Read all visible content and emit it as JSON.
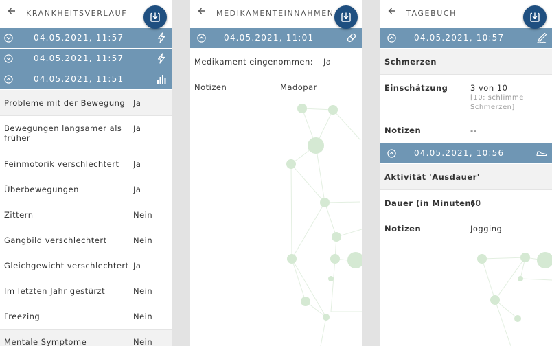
{
  "panel1": {
    "title": "KRANKHEITSVERLAUF",
    "entries": [
      {
        "datetime": "04.05.2021, 11:57",
        "icon": "lightning-icon"
      },
      {
        "datetime": "04.05.2021, 11:57",
        "icon": "lightning-icon"
      },
      {
        "datetime": "04.05.2021, 11:51",
        "icon": "bar-chart-icon"
      }
    ],
    "rows": [
      {
        "label": "Probleme mit der Bewegung",
        "value": "Ja"
      },
      {
        "label": "Bewegungen langsamer als früher",
        "value": "Ja"
      },
      {
        "label": "Feinmotorik verschlechtert",
        "value": "Ja"
      },
      {
        "label": "Überbewegungen",
        "value": "Ja"
      },
      {
        "label": "Zittern",
        "value": "Nein"
      },
      {
        "label": "Gangbild verschlechtert",
        "value": "Nein"
      },
      {
        "label": "Gleichgewicht verschlechtert",
        "value": "Ja"
      },
      {
        "label": "Im letzten Jahr gestürzt",
        "value": "Nein"
      },
      {
        "label": "Freezing",
        "value": "Nein"
      },
      {
        "label": "Mentale Symptome",
        "value": "Nein"
      }
    ]
  },
  "panel2": {
    "title": "MEDIKAMENTEINNAHMEN",
    "entry": {
      "datetime": "04.05.2021, 11:01",
      "icon": "pill-icon"
    },
    "rows": [
      {
        "label": "Medikament eingenommen:",
        "value": "Ja"
      },
      {
        "label": "Notizen",
        "value": "Madopar"
      }
    ]
  },
  "panel3": {
    "title": "TAGEBUCH",
    "entry1": {
      "datetime": "04.05.2021, 10:57",
      "icon": "pen-icon"
    },
    "section1": "Schmerzen",
    "rating": {
      "label": "Einschätzung",
      "value": "3 von 10",
      "hint": "[10: schlimme Schmerzen]"
    },
    "notes1": {
      "label": "Notizen",
      "value": "--"
    },
    "entry2": {
      "datetime": "04.05.2021, 10:56",
      "icon": "running-shoe-icon"
    },
    "section2": "Aktivität 'Ausdauer'",
    "duration": {
      "label": "Dauer (in Minuten)",
      "value": "60"
    },
    "notes2": {
      "label": "Notizen",
      "value": "Jogging"
    }
  },
  "icons": {
    "back": "back-arrow-icon",
    "fab": "download-icon",
    "collapse": "chevron-circle-icon"
  },
  "colors": {
    "header_bar": "#6f96b4",
    "fab": "#1f4f80",
    "section_bg": "#f2f2f2",
    "network": "#d4e8d2"
  }
}
